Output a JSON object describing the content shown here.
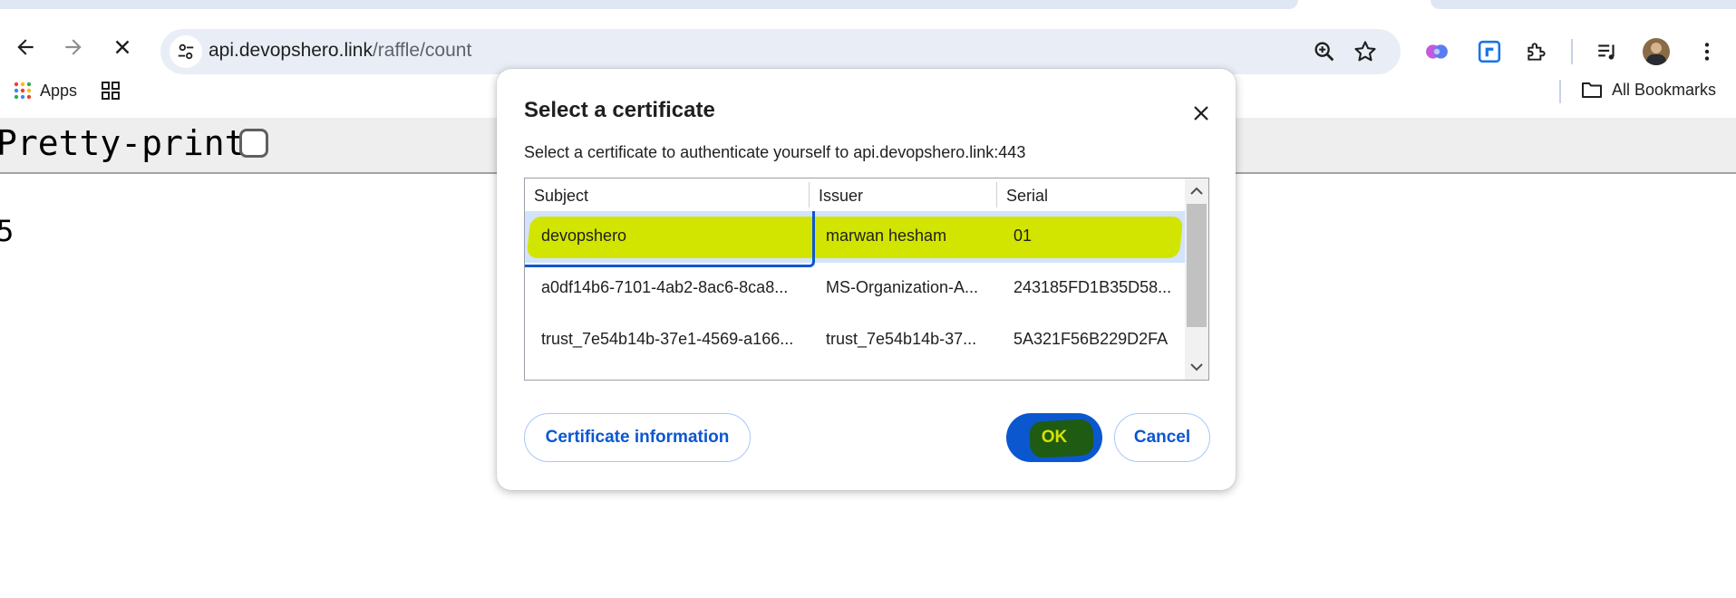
{
  "browser": {
    "url_host": "api.devopshero.link",
    "url_path": "/raffle/count",
    "bookmarks": {
      "apps_label": "Apps",
      "all_bookmarks_label": "All Bookmarks"
    }
  },
  "page": {
    "pretty_print_label": "Pretty-print",
    "pretty_print_checked": false,
    "body_value": "5"
  },
  "dialog": {
    "title": "Select a certificate",
    "description": "Select a certificate to authenticate yourself to api.devopshero.link:443",
    "columns": [
      "Subject",
      "Issuer",
      "Serial"
    ],
    "rows": [
      {
        "subject": "devopshero",
        "issuer": "marwan hesham",
        "serial": "01",
        "selected": true
      },
      {
        "subject": "a0df14b6-7101-4ab2-8ac6-8ca8...",
        "issuer": "MS-Organization-A...",
        "serial": "243185FD1B35D58..."
      },
      {
        "subject": "trust_7e54b14b-37e1-4569-a166...",
        "issuer": "trust_7e54b14b-37...",
        "serial": "5A321F56B229D2FA"
      }
    ],
    "buttons": {
      "info": "Certificate information",
      "ok": "OK",
      "cancel": "Cancel"
    }
  },
  "colors": {
    "accent": "#0b57d0",
    "highlight": "#d2e500",
    "selected_row": "#d3e3fd"
  }
}
